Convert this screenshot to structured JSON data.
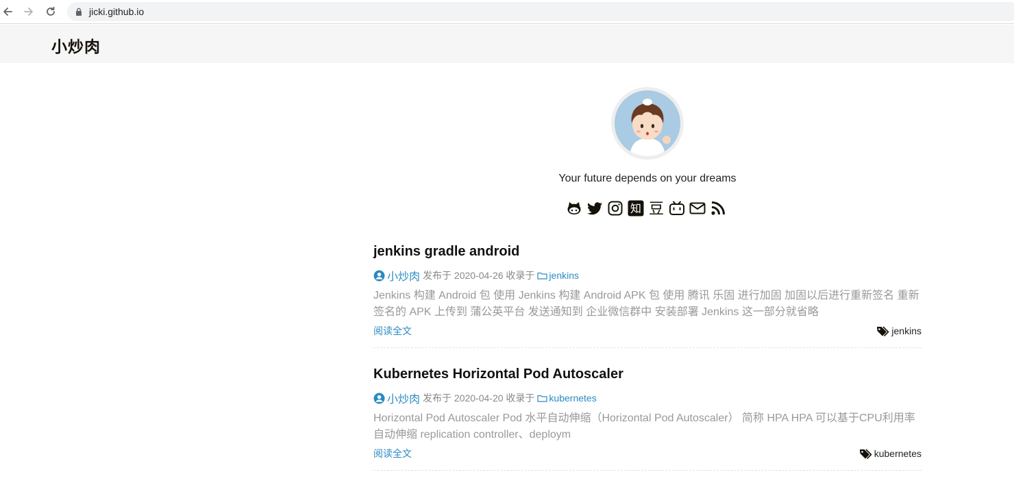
{
  "browser": {
    "url": "jicki.github.io"
  },
  "site": {
    "title": "小炒肉"
  },
  "profile": {
    "motto": "Your future depends on your dreams",
    "social": [
      "github-icon",
      "twitter-icon",
      "instagram-icon",
      "zhihu-icon",
      "douban-icon",
      "bilibili-icon",
      "mail-icon",
      "rss-icon"
    ],
    "zhihu_glyph": "知",
    "douban_glyph": "豆"
  },
  "posts": [
    {
      "title": "jenkins gradle android",
      "author": "小炒肉",
      "published_label": "发布于 2020-04-26 收录于",
      "category": "jenkins",
      "excerpt": "Jenkins 构建 Android 包 使用 Jenkins 构建 Android APK 包 使用 腾讯 乐固 进行加固 加固以后进行重新签名 重新签名的 APK 上传到 蒲公英平台 发送通知到 企业微信群中 安装部署 Jenkins 这一部分就省略",
      "read_more": "阅读全文",
      "tag": "jenkins"
    },
    {
      "title": "Kubernetes Horizontal Pod Autoscaler",
      "author": "小炒肉",
      "published_label": "发布于 2020-04-20 收录于",
      "category": "kubernetes",
      "excerpt": "Horizontal Pod Autoscaler Pod 水平自动伸缩（Horizontal Pod Autoscaler） 简称 HPA HPA 可以基于CPU利用率自动伸缩 replication controller、deploym",
      "read_more": "阅读全文",
      "tag": "kubernetes"
    }
  ],
  "colors": {
    "link": "#2a8ac2",
    "muted": "#999999",
    "header_bg": "#f6f6f6"
  }
}
